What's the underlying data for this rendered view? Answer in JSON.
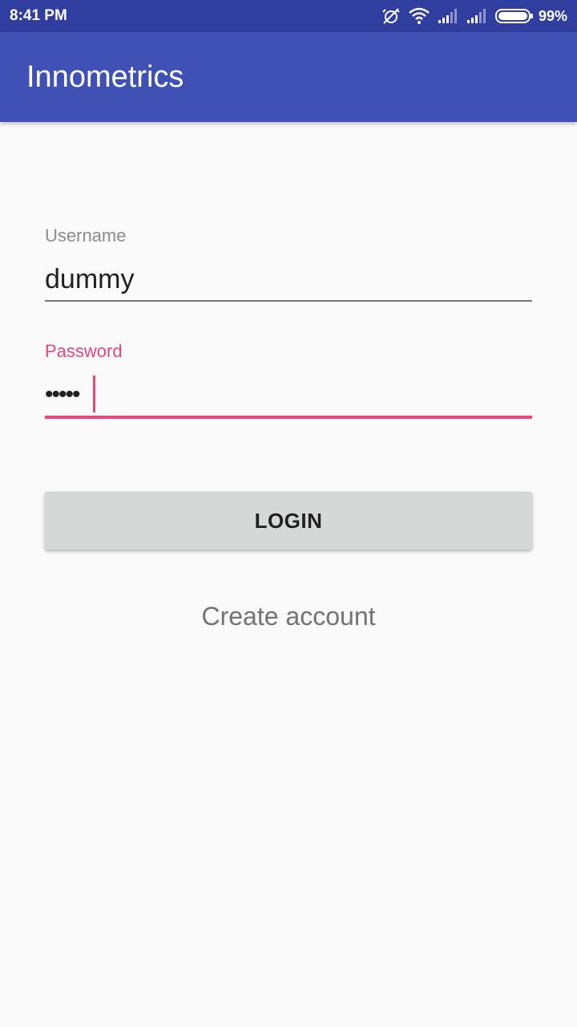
{
  "status_bar": {
    "time": "8:41 PM",
    "battery_percent": "99%",
    "icons": [
      "alarm-off-icon",
      "wifi-icon",
      "signal-icon",
      "signal-icon",
      "battery-icon"
    ]
  },
  "app_bar": {
    "title": "Innometrics"
  },
  "form": {
    "username": {
      "label": "Username",
      "value": "dummy"
    },
    "password": {
      "label": "Password",
      "masked_value": "•••••"
    },
    "login_label": "LOGIN",
    "create_account_label": "Create account"
  },
  "colors": {
    "status_bar": "#303f9f",
    "app_bar": "#3f51b5",
    "accent": "#e8457f",
    "background": "#fafafa",
    "button": "#d6d7d7"
  }
}
